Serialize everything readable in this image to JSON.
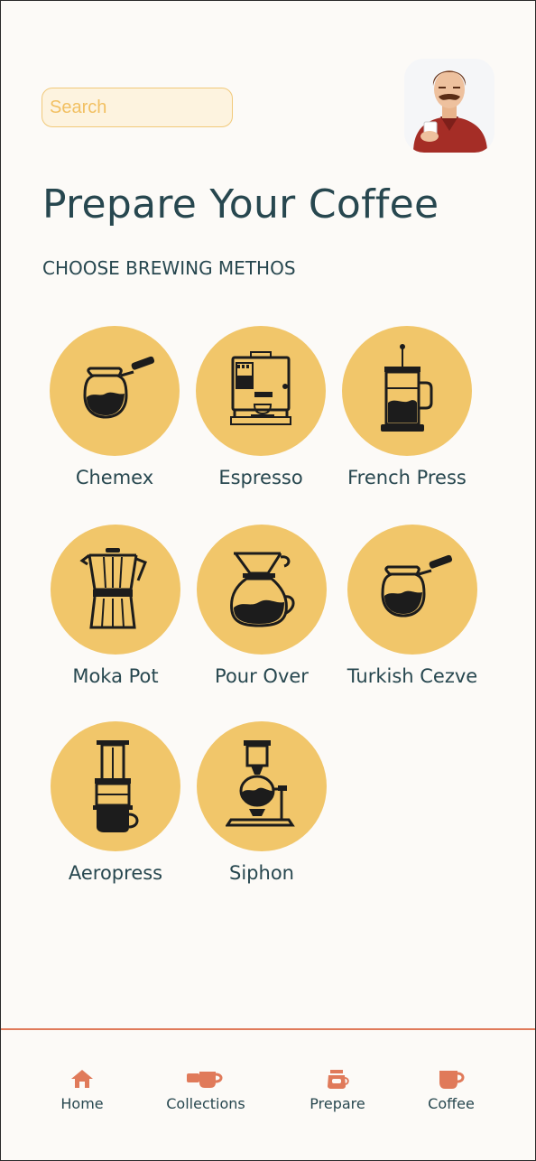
{
  "search": {
    "placeholder": "Search"
  },
  "header": {
    "title": "Prepare Your Coffee",
    "subtitle": "CHOOSE BREWING METHOS",
    "avatar_icon": "user-avatar"
  },
  "methods": [
    {
      "label": "Chemex",
      "icon": "cezve-icon"
    },
    {
      "label": "Espresso",
      "icon": "espresso-machine-icon"
    },
    {
      "label": "French Press",
      "icon": "french-press-icon"
    },
    {
      "label": "Moka Pot",
      "icon": "moka-pot-icon"
    },
    {
      "label": "Pour Over",
      "icon": "pour-over-icon"
    },
    {
      "label": "Turkish Cezve",
      "icon": "cezve-icon"
    },
    {
      "label": "Aeropress",
      "icon": "aeropress-icon"
    },
    {
      "label": "Siphon",
      "icon": "siphon-icon"
    }
  ],
  "nav": [
    {
      "label": "Home",
      "icon": "home-icon"
    },
    {
      "label": "Collections",
      "icon": "cups-icon"
    },
    {
      "label": "Prepare",
      "icon": "coffee-pot-icon"
    },
    {
      "label": "Coffee",
      "icon": "mug-icon"
    }
  ],
  "colors": {
    "background": "#fcfaf7",
    "accent": "#f1c66a",
    "text": "#27474f",
    "nav_accent": "#e07a5a",
    "search_bg": "#fdf3df"
  }
}
